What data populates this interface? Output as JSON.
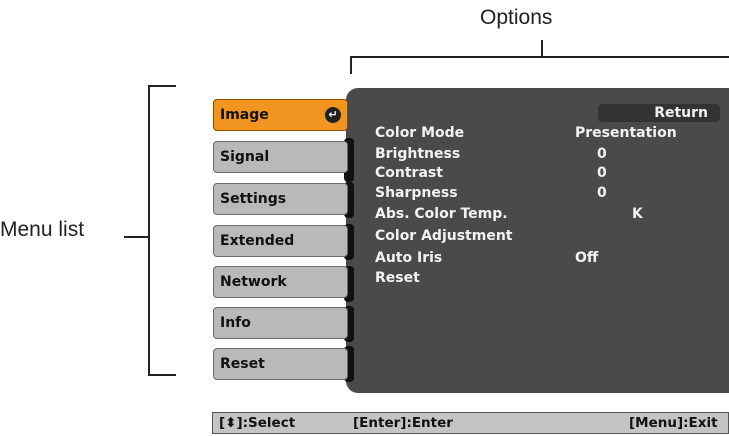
{
  "callouts": {
    "options": "Options",
    "menu_list": "Menu list"
  },
  "menu_list": [
    {
      "label": "Image",
      "selected": true
    },
    {
      "label": "Signal",
      "selected": false
    },
    {
      "label": "Settings",
      "selected": false
    },
    {
      "label": "Extended",
      "selected": false
    },
    {
      "label": "Network",
      "selected": false
    },
    {
      "label": "Info",
      "selected": false
    },
    {
      "label": "Reset",
      "selected": false
    }
  ],
  "options_panel": {
    "return_label": "Return",
    "rows": [
      {
        "label": "Color Mode",
        "value": "Presentation"
      },
      {
        "label": "Brightness",
        "value": "0"
      },
      {
        "label": "Contrast",
        "value": "0"
      },
      {
        "label": "Sharpness",
        "value": "0"
      },
      {
        "label": "Abs. Color Temp.",
        "value": "K"
      },
      {
        "label": "Color Adjustment",
        "value": ""
      },
      {
        "label": "Auto Iris",
        "value": "Off"
      },
      {
        "label": "Reset",
        "value": ""
      }
    ]
  },
  "status_bar": {
    "select_hint": "[⬍]:Select",
    "enter_hint": "[Enter]:Enter",
    "exit_hint": "[Menu]:Exit"
  },
  "colors": {
    "selected_tab": "#f29420",
    "tab": "#b9b9b9",
    "panel": "#4a4a4a"
  },
  "icons": {
    "enter": "enter-icon"
  }
}
